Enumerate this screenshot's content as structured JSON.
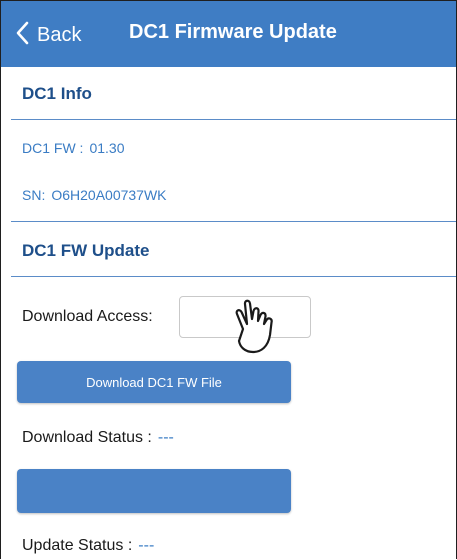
{
  "navbar": {
    "back_label": "Back",
    "title": "DC1 Firmware Update"
  },
  "info": {
    "section_title": "DC1 Info",
    "fw_label": "DC1 FW :",
    "fw_value": "01.30",
    "sn_label": "SN:",
    "sn_value": "O6H20A00737WK"
  },
  "update": {
    "section_title": "DC1 FW Update",
    "download_access_label": "Download Access:",
    "download_access_value": "",
    "download_button_label": "Download DC1 FW File",
    "download_status_label": "Download Status :",
    "download_status_value": "---",
    "update_button_label": "",
    "update_status_label": "Update Status :",
    "update_status_value": "---"
  },
  "colors": {
    "navbar": "#3f7dc4",
    "section_title": "#1e4f8a",
    "accent_text": "#3a7cc4",
    "button": "#4a82c6"
  },
  "icons": {
    "back": "chevron-left-icon",
    "pointer": "hand-pointer-icon"
  }
}
